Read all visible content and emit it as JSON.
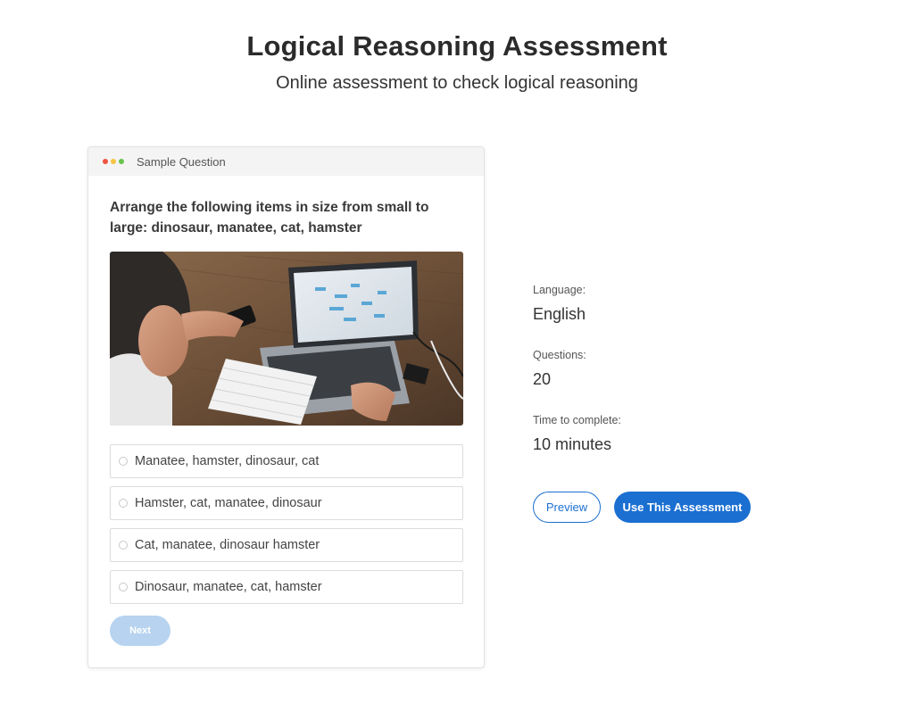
{
  "header": {
    "title": "Logical Reasoning Assessment",
    "subtitle": "Online assessment to check logical reasoning"
  },
  "sample_card": {
    "header_label": "Sample Question",
    "window_dot_colors": [
      "#f0533f",
      "#f6c443",
      "#67c24a"
    ],
    "question": "Arrange the following items in size from small to large: dinosaur, manatee, cat, hamster",
    "image_subject": "person-using-laptop-photo",
    "options": [
      {
        "label": "Manatee, hamster, dinosaur, cat",
        "selected": false
      },
      {
        "label": "Hamster, cat, manatee, dinosaur",
        "selected": false
      },
      {
        "label": "Cat, manatee, dinosaur hamster",
        "selected": false
      },
      {
        "label": "Dinosaur, manatee, cat, hamster",
        "selected": false
      }
    ],
    "next_label": "Next"
  },
  "details": {
    "language_label": "Language:",
    "language_value": "English",
    "questions_label": "Questions:",
    "questions_value": "20",
    "time_label": "Time to complete:",
    "time_value": "10 minutes"
  },
  "actions": {
    "preview_label": "Preview",
    "use_label": "Use This Assessment"
  },
  "colors": {
    "accent": "#1a6fd1",
    "next_disabled": "#b7d3ef"
  }
}
